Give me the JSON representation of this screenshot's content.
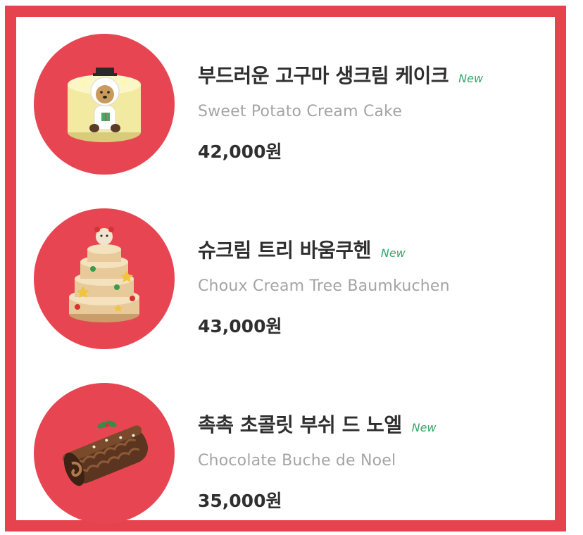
{
  "products": [
    {
      "name_ko": "부드러운 고구마 생크림 케이크",
      "badge": "New",
      "name_en": "Sweet Potato Cream Cake",
      "price": "42,000원",
      "image": "sweet-potato-cake-image"
    },
    {
      "name_ko": "슈크림 트리 바움쿠헨",
      "badge": "New",
      "name_en": "Choux Cream Tree Baumkuchen",
      "price": "43,000원",
      "image": "baumkuchen-tree-image"
    },
    {
      "name_ko": "촉촉 초콜릿 부쉬 드 노엘",
      "badge": "New",
      "name_en": "Chocolate Buche de Noel",
      "price": "35,000원",
      "image": "buche-de-noel-image"
    }
  ],
  "colors": {
    "frame": "#e5434d",
    "thumb_bg": "#e84552",
    "badge": "#3aa56b",
    "title": "#2f2f2f",
    "subtitle": "#a4a4a4"
  }
}
